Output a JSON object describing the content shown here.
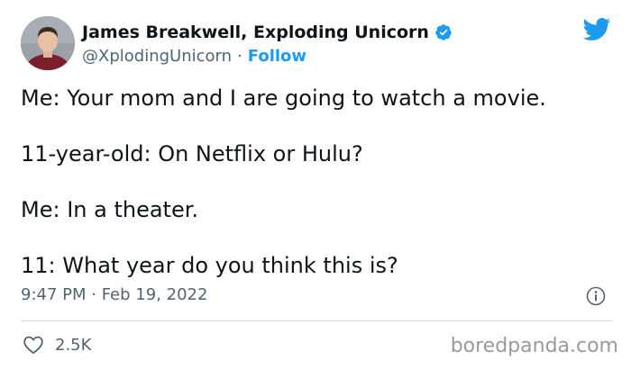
{
  "author": {
    "display_name": "James Breakwell, Exploding Unicorn",
    "handle": "@XplodingUnicorn",
    "separator": "·",
    "follow_label": "Follow",
    "verified": true
  },
  "tweet": {
    "lines": [
      "Me: Your mom and I are going to watch a movie.",
      "11-year-old: On Netflix or Hulu?",
      "Me: In a theater.",
      "11: What year do you think this is?"
    ],
    "timestamp": "9:47 PM · Feb 19, 2022"
  },
  "engagement": {
    "likes": "2.5K"
  },
  "watermark": "boredpanda.com",
  "icons": {
    "logo": "twitter-bird-icon",
    "verified": "verified-badge-icon",
    "info": "info-icon",
    "like": "heart-icon"
  },
  "colors": {
    "brand_blue": "#1d9bf0",
    "text_primary": "#0f1419",
    "text_secondary": "#536471",
    "divider": "#cfd9de"
  }
}
